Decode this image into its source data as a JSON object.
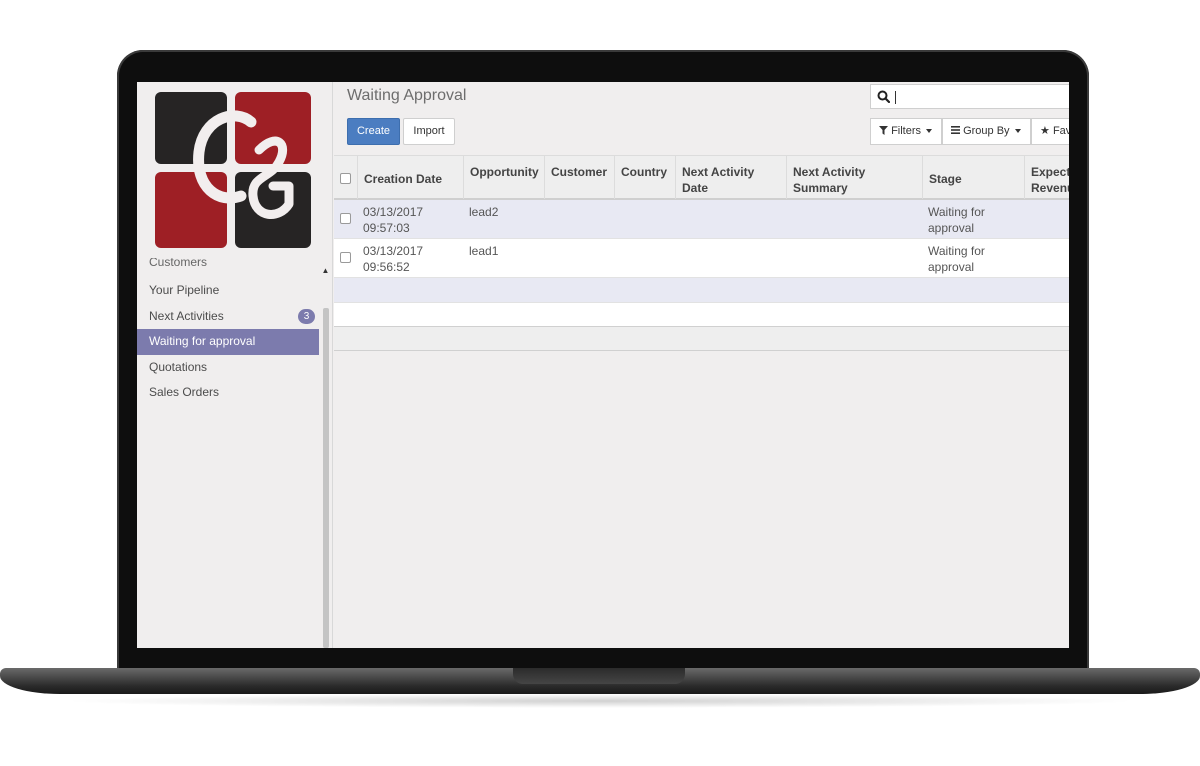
{
  "colors": {
    "accent": "#7c7bad",
    "primary_button": "#4b7dc1",
    "logo_red": "#9e1f25",
    "logo_dark": "#262424"
  },
  "sidebar": {
    "cut_item_label": "Customers",
    "items": [
      {
        "label": "Your Pipeline",
        "active": false
      },
      {
        "label": "Next Activities",
        "active": false,
        "badge": "3"
      },
      {
        "label": "Waiting for approval",
        "active": true
      },
      {
        "label": "Quotations",
        "active": false
      },
      {
        "label": "Sales Orders",
        "active": false
      }
    ]
  },
  "header": {
    "title": "Waiting Approval",
    "search_value": "",
    "create_label": "Create",
    "import_label": "Import",
    "filters_label": "Filters",
    "groupby_label": "Group By",
    "favorites_label": "Fav"
  },
  "table": {
    "columns": [
      "Creation Date",
      "Opportunity",
      "Customer",
      "Country",
      "Next Activity Date",
      "Next Activity Summary",
      "Stage",
      "Expected Revenue"
    ],
    "col_labels": {
      "creation_date": "Creation Date",
      "opportunity": "Opportunity",
      "customer": "Customer",
      "country": "Country",
      "next_activity_date_1": "Next Activity",
      "next_activity_date_2": "Date",
      "next_activity_summary_1": "Next Activity",
      "next_activity_summary_2": "Summary",
      "stage": "Stage",
      "expected_revenue_1": "Expect",
      "expected_revenue_2": "Revenu"
    },
    "rows": [
      {
        "date": "03/13/2017",
        "time": "09:57:03",
        "opportunity": "lead2",
        "stage_1": "Waiting for",
        "stage_2": "approval"
      },
      {
        "date": "03/13/2017",
        "time": "09:56:52",
        "opportunity": "lead1",
        "stage_1": "Waiting for",
        "stage_2": "approval"
      }
    ]
  }
}
